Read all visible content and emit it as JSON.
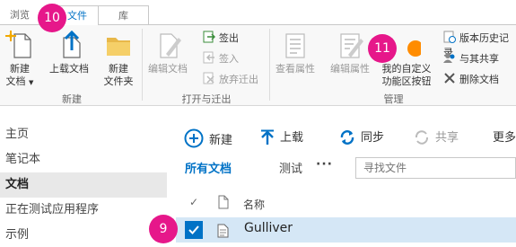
{
  "tabs": {
    "browse": "浏览",
    "files": "文件",
    "library": "库"
  },
  "ribbon": {
    "new_doc": [
      "新建",
      "文档"
    ],
    "upload_doc": "上载文档",
    "new_folder": [
      "新建",
      "文件夹"
    ],
    "group_new": "新建",
    "edit_doc": "编辑文档",
    "checkout": "签出",
    "checkin": "签入",
    "discard_checkout": "放弃迁出",
    "group_open": "打开与迁出",
    "view_props": "查看属性",
    "edit_props": "编辑属性",
    "custom_btn": [
      "我的自定义",
      "功能区按钮"
    ],
    "group_manage": "管理",
    "version_history": "版本历史记录",
    "share_with": "与其共享",
    "delete_doc": "删除文档"
  },
  "leftnav": {
    "items": [
      "主页",
      "笔记本",
      "文档",
      "正在测试应用程序",
      "示例"
    ]
  },
  "commands": {
    "new": "新建",
    "upload": "上载",
    "sync": "同步",
    "share": "共享",
    "more": "更多"
  },
  "views": {
    "all_docs": "所有文档",
    "test": "测试",
    "more": "···"
  },
  "search": {
    "placeholder": "寻找文件"
  },
  "table": {
    "col_name": "名称",
    "rows": [
      {
        "name": "Gulliver"
      }
    ]
  },
  "badges": {
    "b9": "9",
    "b10": "10",
    "b11": "11"
  },
  "colors": {
    "accent": "#0072c6",
    "badge": "#e6178a",
    "orange_dot": "#ff8c00",
    "selected_row": "#d5e7f6"
  }
}
